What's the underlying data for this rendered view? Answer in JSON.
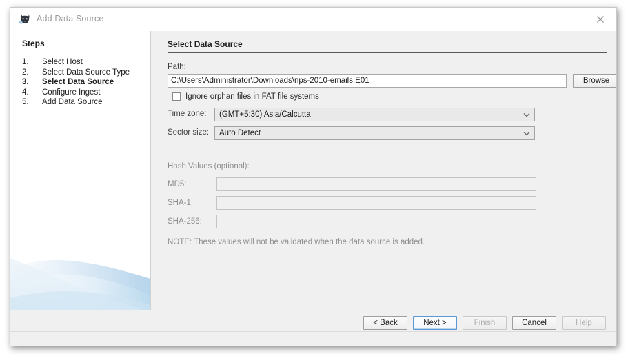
{
  "window": {
    "title": "Add Data Source",
    "icon": "autopsy-logo-icon",
    "close_label": "×"
  },
  "steps": {
    "heading": "Steps",
    "items": [
      {
        "num": "1.",
        "label": "Select Host",
        "current": false
      },
      {
        "num": "2.",
        "label": "Select Data Source Type",
        "current": false
      },
      {
        "num": "3.",
        "label": "Select Data Source",
        "current": true
      },
      {
        "num": "4.",
        "label": "Configure Ingest",
        "current": false
      },
      {
        "num": "5.",
        "label": "Add Data Source",
        "current": false
      }
    ]
  },
  "content": {
    "heading": "Select Data Source",
    "path_label": "Path:",
    "path_value": "C:\\Users\\Administrator\\Downloads\\nps-2010-emails.E01",
    "browse_label": "Browse",
    "ignore_orphan_label": "Ignore orphan files in FAT file systems",
    "ignore_orphan_checked": false,
    "timezone_label": "Time zone:",
    "timezone_value": "(GMT+5:30) Asia/Calcutta",
    "sector_label": "Sector size:",
    "sector_value": "Auto Detect",
    "hash_heading": "Hash Values (optional):",
    "md5_label": "MD5:",
    "md5_value": "",
    "sha1_label": "SHA-1:",
    "sha1_value": "",
    "sha256_label": "SHA-256:",
    "sha256_value": "",
    "note": "NOTE: These values will not be validated when the data source is added."
  },
  "footer": {
    "back_label": "< Back",
    "next_label": "Next >",
    "finish_label": "Finish",
    "cancel_label": "Cancel",
    "help_label": "Help"
  },
  "colors": {
    "panel_bg": "#f0f0f0",
    "panel_white": "#ffffff",
    "focus_blue": "#5a96d2",
    "disabled_text": "#b0b0b0",
    "swoosh_blue": "#cfe2f2"
  }
}
